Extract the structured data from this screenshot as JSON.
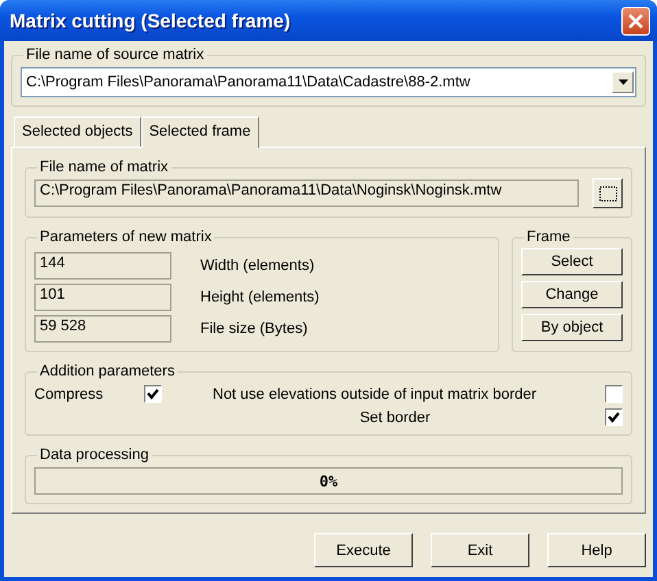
{
  "window": {
    "title": "Matrix cutting (Selected frame)"
  },
  "source_matrix": {
    "label": "File name of source matrix",
    "value": "C:\\Program Files\\Panorama\\Panorama11\\Data\\Cadastre\\88-2.mtw"
  },
  "tabs": [
    {
      "label": "Selected objects",
      "selected": false
    },
    {
      "label": "Selected frame",
      "selected": true
    }
  ],
  "matrix_file": {
    "label": "File name of matrix",
    "value": "C:\\Program Files\\Panorama\\Panorama11\\Data\\Noginsk\\Noginsk.mtw"
  },
  "parameters": {
    "label": "Parameters of new matrix",
    "rows": [
      {
        "value": "144",
        "label": "Width (elements)"
      },
      {
        "value": "101",
        "label": "Height (elements)"
      },
      {
        "value": "59 528",
        "label": "File size (Bytes)"
      }
    ]
  },
  "frame": {
    "label": "Frame",
    "buttons": [
      "Select",
      "Change",
      "By object"
    ]
  },
  "addition": {
    "label": "Addition parameters",
    "options": [
      {
        "label": "Compress",
        "checked": true
      },
      {
        "label": "Not use elevations outside of input matrix border",
        "checked": false
      },
      {
        "label": "Set border",
        "checked": true
      }
    ]
  },
  "processing": {
    "label": "Data processing",
    "level": 0,
    "reading": "0%"
  },
  "buttons": [
    "Execute",
    "Exit",
    "Help"
  ]
}
